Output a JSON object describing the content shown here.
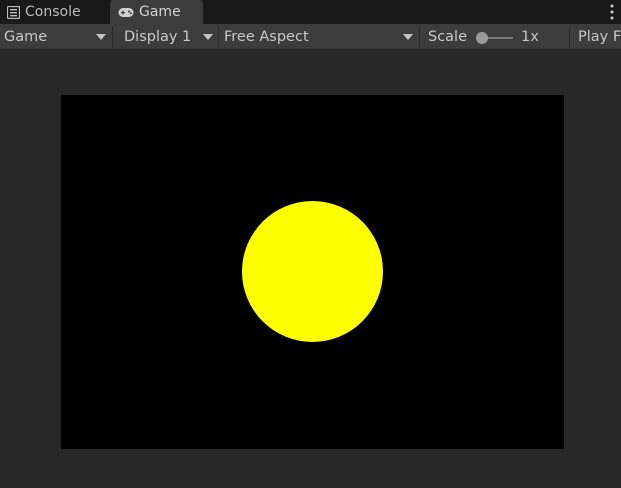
{
  "tabs": {
    "console_label": "Console",
    "game_label": "Game"
  },
  "toolbar": {
    "view_select": "Game",
    "display_select": "Display 1",
    "aspect_select": "Free Aspect",
    "scale_label": "Scale",
    "scale_value": "1x",
    "scale_level": 0,
    "play_focused_label": "Play F"
  },
  "scene": {
    "background_color": "#000000",
    "circle_color": "#ffff00"
  },
  "icons": {
    "console": "console-list-icon",
    "game": "gamepad-icon",
    "more": "kebab-menu-icon"
  }
}
